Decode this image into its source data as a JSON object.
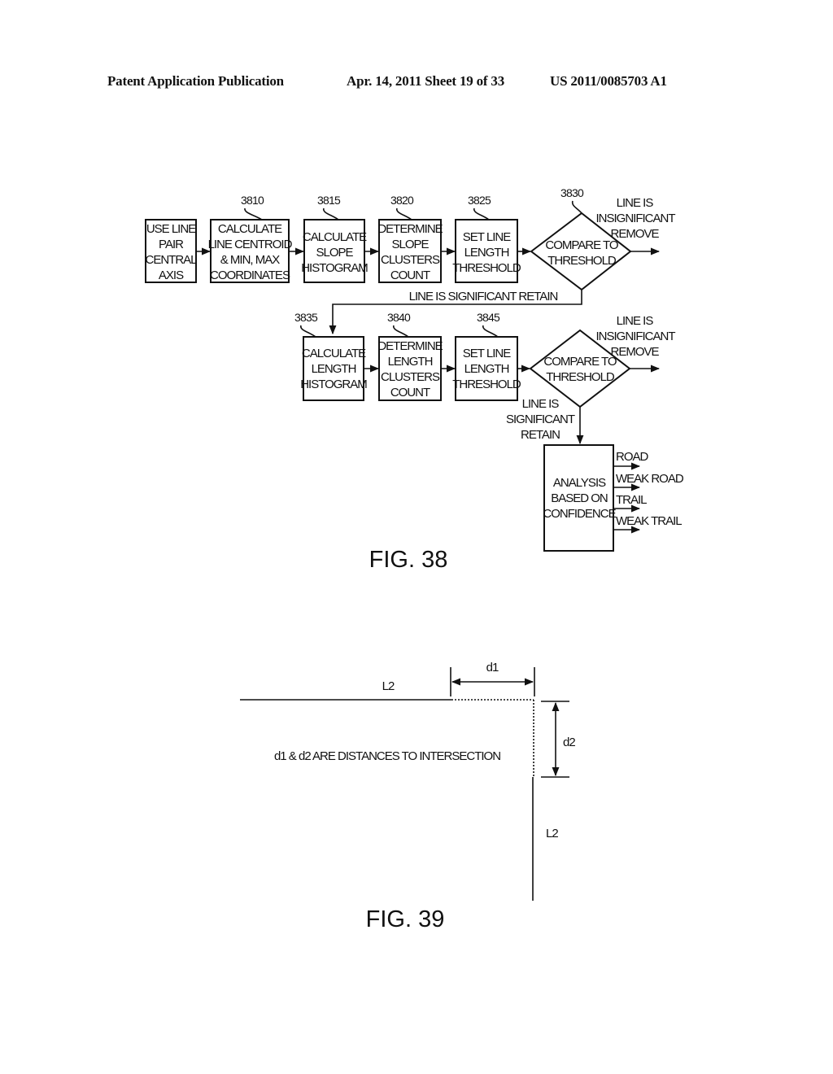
{
  "header": {
    "left": "Patent Application Publication",
    "middle": "Apr. 14, 2011  Sheet 19 of 33",
    "right": "US 2011/0085703 A1"
  },
  "fig38": {
    "caption": "FIG. 38",
    "row1": {
      "boxes": [
        {
          "ref": "",
          "lines": [
            "USE LINE",
            "PAIR",
            "CENTRAL",
            "AXIS"
          ]
        },
        {
          "ref": "3810",
          "lines": [
            "CALCULATE",
            "LINE CENTROID",
            "& MIN, MAX",
            "COORDINATES"
          ]
        },
        {
          "ref": "3815",
          "lines": [
            "CALCULATE",
            "SLOPE",
            "HISTOGRAM"
          ]
        },
        {
          "ref": "3820",
          "lines": [
            "DETERMINE",
            "SLOPE",
            "CLUSTERS",
            "COUNT"
          ]
        },
        {
          "ref": "3825",
          "lines": [
            "SET LINE",
            "LENGTH",
            "THRESHOLD"
          ]
        }
      ],
      "decision": {
        "ref": "3830",
        "lines": [
          "COMPARE TO",
          "THRESHOLD"
        ]
      },
      "insignificant_label": [
        "LINE IS",
        "INSIGNIFICANT",
        "REMOVE"
      ],
      "significant_label": "LINE IS SIGNIFICANT RETAIN"
    },
    "row2": {
      "boxes": [
        {
          "ref": "3835",
          "lines": [
            "CALCULATE",
            "LENGTH",
            "HISTOGRAM"
          ]
        },
        {
          "ref": "3840",
          "lines": [
            "DETERMINE",
            "LENGTH",
            "CLUSTERS",
            "COUNT"
          ]
        },
        {
          "ref": "3845",
          "lines": [
            "SET LINE",
            "LENGTH",
            "THRESHOLD"
          ]
        }
      ],
      "decision": {
        "lines": [
          "COMPARE TO",
          "THRESHOLD"
        ]
      },
      "insignificant_label": [
        "LINE IS",
        "INSIGNIFICANT",
        "REMOVE"
      ],
      "significant_label": [
        "LINE IS",
        "SIGNIFICANT",
        "RETAIN"
      ]
    },
    "analysis": {
      "lines": [
        "ANALYSIS",
        "BASED ON",
        "CONFIDENCE"
      ],
      "outputs": [
        "ROAD",
        "WEAK ROAD",
        "TRAIL",
        "WEAK TRAIL"
      ]
    }
  },
  "fig39": {
    "caption": "FIG. 39",
    "horizontal_line_label": "L2",
    "vertical_line_label": "L2",
    "d1_label": "d1",
    "d2_label": "d2",
    "note": "d1 & d2 ARE DISTANCES TO INTERSECTION"
  }
}
